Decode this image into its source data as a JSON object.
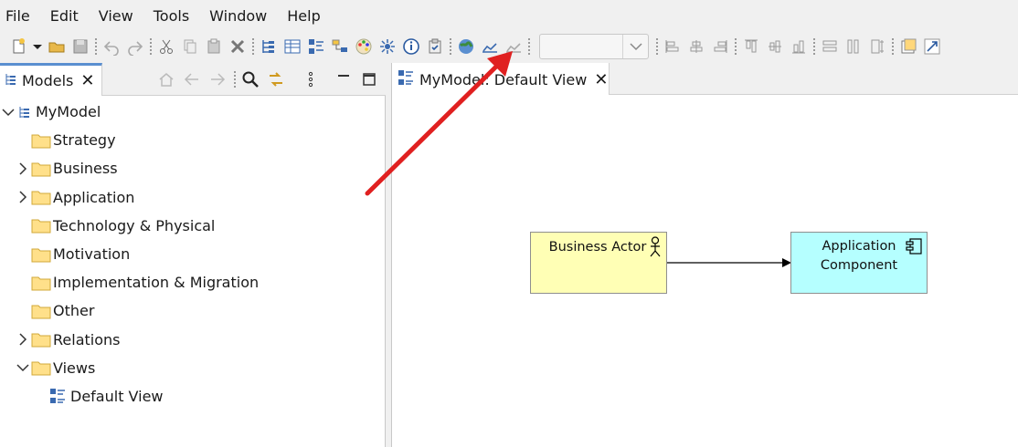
{
  "menu": {
    "items": [
      {
        "label": "File"
      },
      {
        "label": "Edit"
      },
      {
        "label": "View"
      },
      {
        "label": "Tools"
      },
      {
        "label": "Window"
      },
      {
        "label": "Help"
      }
    ]
  },
  "toolbar": {
    "icons": [
      "new-icon",
      "dropdown-arrow-icon",
      "open-folder-icon",
      "save-icon",
      "undo-icon",
      "redo-icon",
      "cut-icon",
      "copy-icon",
      "paste-icon",
      "delete-icon",
      "models-tree-icon",
      "properties-icon",
      "outline-icon",
      "navigator-icon",
      "palette-icon",
      "hints-icon",
      "info-icon",
      "validator-icon",
      "visualiser-icon",
      "chart-icon",
      "export-chart-icon"
    ],
    "combo_value": ""
  },
  "models_panel": {
    "tab_label": "Models",
    "tree": [
      {
        "label": "MyModel",
        "level": 0,
        "expanded": true,
        "icon": "model-icon"
      },
      {
        "label": "Strategy",
        "level": 1,
        "expandable": false,
        "icon": "folder-icon"
      },
      {
        "label": "Business",
        "level": 1,
        "expandable": true,
        "icon": "folder-icon"
      },
      {
        "label": "Application",
        "level": 1,
        "expandable": true,
        "icon": "folder-icon"
      },
      {
        "label": "Technology & Physical",
        "level": 1,
        "expandable": false,
        "icon": "folder-icon"
      },
      {
        "label": "Motivation",
        "level": 1,
        "expandable": false,
        "icon": "folder-icon"
      },
      {
        "label": "Implementation & Migration",
        "level": 1,
        "expandable": false,
        "icon": "folder-icon"
      },
      {
        "label": "Other",
        "level": 1,
        "expandable": false,
        "icon": "folder-icon"
      },
      {
        "label": "Relations",
        "level": 1,
        "expandable": true,
        "icon": "folder-icon"
      },
      {
        "label": "Views",
        "level": 1,
        "expanded": true,
        "icon": "folder-icon"
      },
      {
        "label": "Default View",
        "level": 2,
        "expandable": false,
        "icon": "view-icon"
      }
    ]
  },
  "editor": {
    "tab_label": "MyModel: Default View",
    "elements": {
      "actor": {
        "label": "Business Actor",
        "color": "#ffffb5"
      },
      "app_line1": "Application",
      "app_line2": "Component",
      "app_color": "#b5ffff"
    }
  },
  "colors": {
    "accent": "#5a8fd0",
    "annotation_arrow": "#e02020"
  }
}
